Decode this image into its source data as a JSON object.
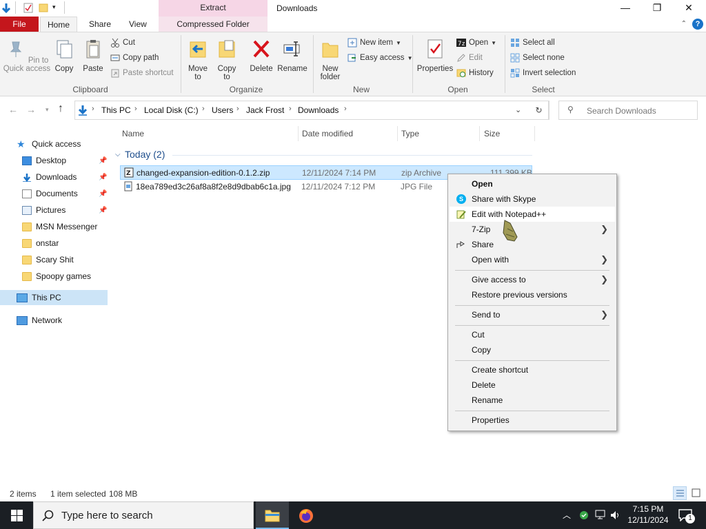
{
  "window": {
    "title": "Downloads",
    "context_tab": "Extract",
    "controls": {
      "minimize": "—",
      "maximize": "❐",
      "close": "✕"
    }
  },
  "ribbon_tabs": [
    "File",
    "Home",
    "Share",
    "View",
    "Compressed Folder Tools"
  ],
  "ribbon": {
    "clipboard": {
      "pin": "Pin to Quick access",
      "copy": "Copy",
      "paste": "Paste",
      "cut": "Cut",
      "copy_path": "Copy path",
      "paste_shortcut": "Paste shortcut",
      "label": "Clipboard"
    },
    "organize": {
      "move_to": "Move to",
      "copy_to": "Copy to",
      "delete": "Delete",
      "rename": "Rename",
      "label": "Organize"
    },
    "new": {
      "new_folder": "New folder",
      "new_item": "New item",
      "easy_access": "Easy access",
      "label": "New"
    },
    "open": {
      "properties": "Properties",
      "open": "Open",
      "edit": "Edit",
      "history": "History",
      "label": "Open"
    },
    "select": {
      "select_all": "Select all",
      "select_none": "Select none",
      "invert": "Invert selection",
      "label": "Select"
    }
  },
  "address": {
    "crumbs": [
      "This PC",
      "Local Disk (C:)",
      "Users",
      "Jack Frost",
      "Downloads"
    ],
    "search_placeholder": "Search Downloads"
  },
  "nav": {
    "quick_access": "Quick access",
    "items": [
      "Desktop",
      "Downloads",
      "Documents",
      "Pictures",
      "MSN Messenger",
      "onstar",
      "Scary Shit",
      "Spoopy games"
    ],
    "this_pc": "This PC",
    "network": "Network"
  },
  "columns": {
    "name": "Name",
    "date": "Date modified",
    "type": "Type",
    "size": "Size"
  },
  "group": "Today (2)",
  "files": [
    {
      "name": "changed-expansion-edition-0.1.2.zip",
      "date": "12/11/2024 7:14 PM",
      "type": "zip Archive",
      "size": "111,399 KB"
    },
    {
      "name": "18ea789ed3c26af8a8f2e8d9dbab6c1a.jpg",
      "date": "12/11/2024 7:12 PM",
      "type": "JPG File",
      "size": ""
    }
  ],
  "context_menu": {
    "open": "Open",
    "skype": "Share with Skype",
    "notepad": "Edit with Notepad++",
    "zip": "7-Zip",
    "share": "Share",
    "open_with": "Open with",
    "give_access": "Give access to",
    "restore": "Restore previous versions",
    "send_to": "Send to",
    "cut": "Cut",
    "copy": "Copy",
    "create_shortcut": "Create shortcut",
    "delete": "Delete",
    "rename": "Rename",
    "properties": "Properties"
  },
  "status": {
    "items": "2 items",
    "selected": "1 item selected",
    "size": "108 MB"
  },
  "taskbar": {
    "search_placeholder": "Type here to search",
    "time": "7:15 PM",
    "date": "12/11/2024",
    "notification_count": "1"
  },
  "colors": {
    "file_tab": "#c4161c",
    "selection": "#cce8ff",
    "taskbar": "#1b1f24",
    "accent": "#1a73c8"
  }
}
